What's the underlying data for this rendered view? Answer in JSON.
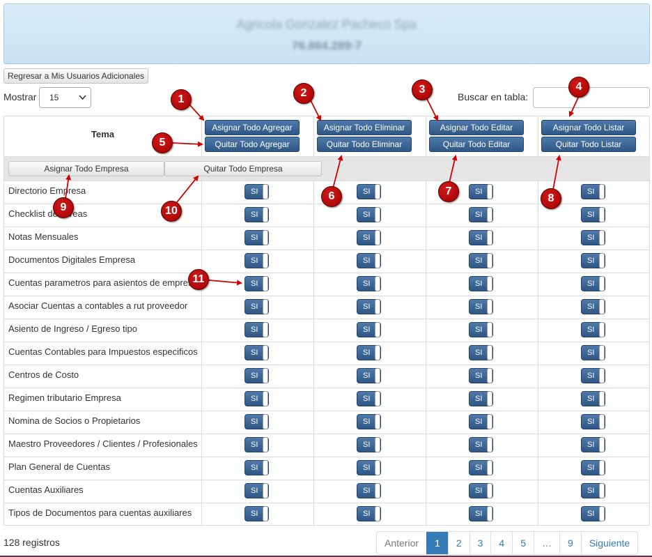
{
  "header": {
    "company_name": "Agricola Gonzalez Pacheco Spa",
    "rut": "76.864.289-7"
  },
  "back_button_label": "Regresar a Mis Usuarios Adicionales",
  "mostrar_label": "Mostrar",
  "page_size_value": "15",
  "search_label": "Buscar en tabla:",
  "search_value": "",
  "table": {
    "tema_header": "Tema",
    "columns": [
      {
        "assign_label": "Asignar Todo Agregar",
        "remove_label": "Quitar Todo Agregar"
      },
      {
        "assign_label": "Asignar Todo Eliminar",
        "remove_label": "Quitar Todo Eliminar"
      },
      {
        "assign_label": "Asignar Todo Editar",
        "remove_label": "Quitar Todo Editar"
      },
      {
        "assign_label": "Asignar Todo Listar",
        "remove_label": "Quitar Todo Listar"
      }
    ],
    "empresa_assign_label": "Asignar Todo Empresa",
    "empresa_remove_label": "Quitar Todo Empresa",
    "toggle_label": "SI",
    "rows": [
      "Directorio Empresa",
      "Checklist de Tareas",
      "Notas Mensuales",
      "Documentos Digitales Empresa",
      "Cuentas parametros para asientos de empresa",
      "Asociar Cuentas a contables a rut proveedor",
      "Asiento de Ingreso / Egreso tipo",
      "Cuentas Contables para Impuestos especificos",
      "Centros de Costo",
      "Regimen tributario Empresa",
      "Nomina de Socios o Propietarios",
      "Maestro Proveedores / Clientes / Profesionales",
      "Plan General de Cuentas",
      "Cuentas Auxiliares",
      "Tipos de Documentos para cuentas auxiliares"
    ]
  },
  "registros_label": "128 registros",
  "pagination": [
    "Anterior",
    "1",
    "2",
    "3",
    "4",
    "5",
    "…",
    "9",
    "Siguiente"
  ],
  "pagination_active": "1",
  "callouts": [
    "1",
    "2",
    "3",
    "4",
    "5",
    "6",
    "7",
    "8",
    "9",
    "10",
    "11"
  ],
  "colors": {
    "primary_button": "#3b6494",
    "callout_red": "#c00000",
    "active_page": "#337ab7"
  }
}
